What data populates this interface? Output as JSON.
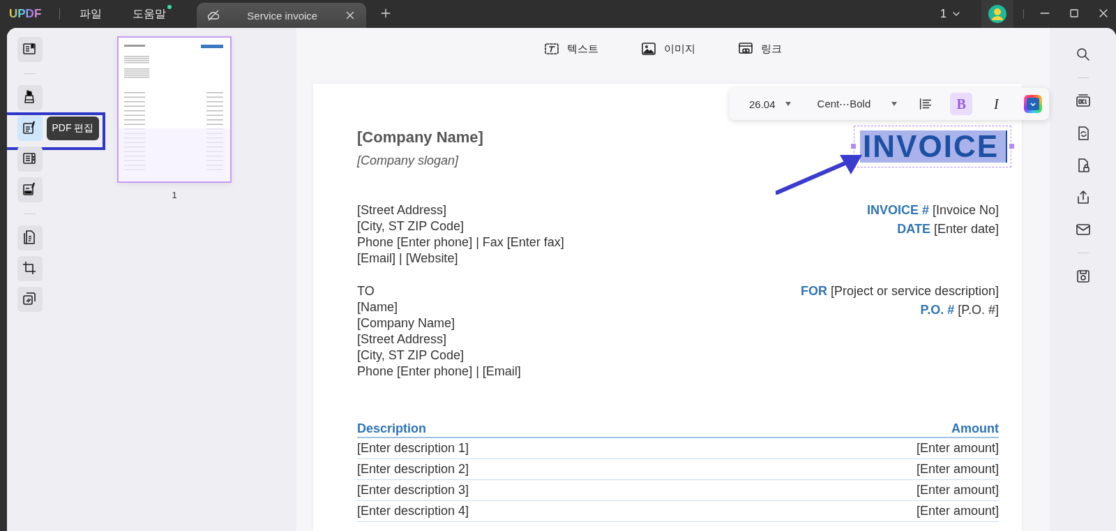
{
  "title_bar": {
    "logo": "UPDF",
    "menus": [
      {
        "label": "파일",
        "badge": false
      },
      {
        "label": "도움말",
        "badge": true
      }
    ],
    "tabs": [
      {
        "title": "Service invoice",
        "selected": true
      }
    ],
    "page_indicator": "1"
  },
  "left_rail": {
    "items": [
      {
        "kind": "tool",
        "selected": false
      },
      {
        "kind": "divider"
      },
      {
        "kind": "tool",
        "selected": false
      },
      {
        "kind": "tool",
        "selected": true
      },
      {
        "kind": "tool",
        "selected": false
      },
      {
        "kind": "tool",
        "selected": false
      },
      {
        "kind": "divider"
      },
      {
        "kind": "tool",
        "selected": false
      },
      {
        "kind": "tool",
        "selected": false
      },
      {
        "kind": "tool",
        "selected": false
      }
    ],
    "tooltip": "PDF 편집"
  },
  "thumbnails": [
    {
      "page": "1",
      "selected": true
    }
  ],
  "edit_toolbar": [
    {
      "label": "텍스트"
    },
    {
      "label": "이미지"
    },
    {
      "label": "링크"
    }
  ],
  "format_toolbar": {
    "font_size": "26.04",
    "font": "Cent⋯Bold",
    "bold": {
      "label": "B",
      "on": true
    },
    "italic": {
      "label": "I",
      "on": false
    }
  },
  "document": {
    "company_name": "[Company Name]",
    "slogan": "[Company slogan]",
    "title": "INVOICE",
    "title_selected": true,
    "sender": [
      "[Street Address]",
      "[City, ST ZIP Code]",
      "Phone [Enter phone] | Fax [Enter fax]",
      "[Email] | [Website]"
    ],
    "invoice_fields": [
      {
        "label": "INVOICE #",
        "value": "[Invoice No]"
      },
      {
        "label": "DATE",
        "value": "[Enter date]"
      }
    ],
    "recipient": [
      "TO",
      "[Name]",
      "[Company Name]",
      "[Street Address]",
      "[City, ST ZIP Code]",
      "Phone [Enter phone] | [Email]"
    ],
    "project_fields": [
      {
        "label": "FOR",
        "value": "[Project or service description]"
      },
      {
        "label": "P.O. #",
        "value": "[P.O. #]"
      }
    ],
    "table": {
      "columns": [
        "Description",
        "Amount"
      ],
      "rows": [
        [
          "[Enter description 1]",
          "[Enter amount]"
        ],
        [
          "[Enter description 2]",
          "[Enter amount]"
        ],
        [
          "[Enter description 3]",
          "[Enter amount]"
        ],
        [
          "[Enter description 4]",
          "[Enter amount]"
        ]
      ]
    }
  }
}
